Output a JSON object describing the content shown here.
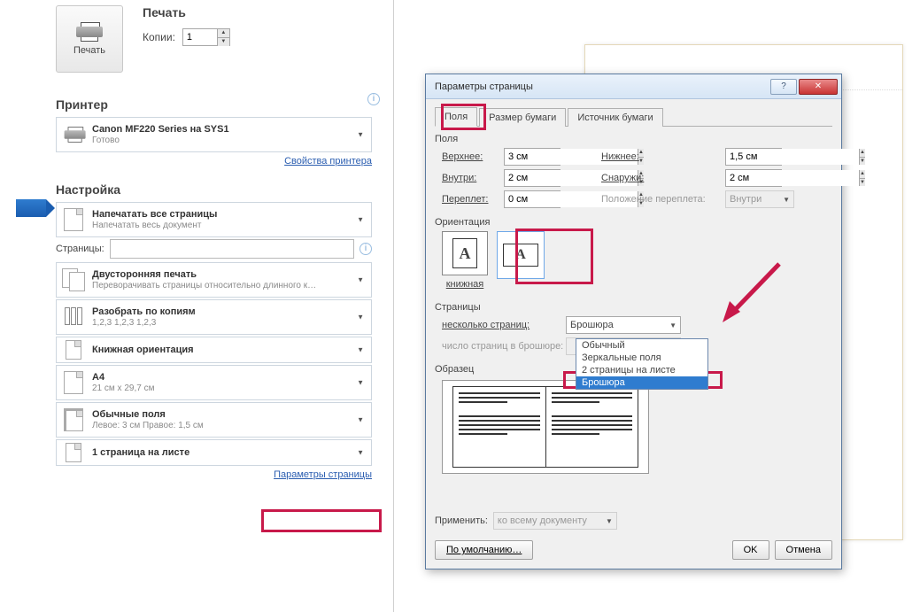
{
  "print_panel": {
    "title": "Печать",
    "print_button": "Печать",
    "copies_label": "Копии:",
    "copies_value": "1",
    "printer_section": "Принтер",
    "printer_name": "Canon MF220 Series на SYS1",
    "printer_status": "Готово",
    "printer_props_link": "Свойства принтера",
    "settings_section": "Настройка",
    "opt_allpages_title": "Напечатать все страницы",
    "opt_allpages_sub": "Напечатать весь документ",
    "pages_label": "Страницы:",
    "pages_value": "",
    "opt_duplex_title": "Двусторонняя печать",
    "opt_duplex_sub": "Переворачивать страницы относительно длинного к…",
    "opt_collate_title": "Разобрать по копиям",
    "opt_collate_sub": "1,2,3   1,2,3   1,2,3",
    "opt_orient_title": "Книжная ориентация",
    "opt_paper_title": "A4",
    "opt_paper_sub": "21 см x 29,7 см",
    "opt_margins_title": "Обычные поля",
    "opt_margins_sub": "Левое: 3 см   Правое: 1,5 см",
    "opt_perpage_title": "1 страница на листе",
    "page_params_link": "Параметры страницы"
  },
  "dialog": {
    "title": "Параметры страницы",
    "tabs": {
      "fields": "Поля",
      "paper": "Размер бумаги",
      "source": "Источник бумаги"
    },
    "fields_group": "Поля",
    "labels": {
      "top": "Верхнее:",
      "bottom": "Нижнее:",
      "inside": "Внутри:",
      "outside": "Снаружи:",
      "gutter": "Переплет:",
      "gutter_pos": "Положение переплета:"
    },
    "values": {
      "top": "3 см",
      "bottom": "1,5 см",
      "inside": "2 см",
      "outside": "2 см",
      "gutter": "0 см",
      "gutter_pos": "Внутри"
    },
    "orientation_group": "Ориентация",
    "orientation_portrait": "книжная",
    "pages_group": "Страницы",
    "multipage_label": "несколько страниц:",
    "multipage_value": "Брошюра",
    "multipage_options": [
      "Обычный",
      "Зеркальные поля",
      "2 страницы на листе",
      "Брошюра"
    ],
    "brochure_pages_label": "число страниц в брошюре:",
    "sample_group": "Образец",
    "apply_label": "Применить:",
    "apply_value": "ко всему документу",
    "buttons": {
      "default": "По умолчанию…",
      "ok": "OK",
      "cancel": "Отмена"
    }
  }
}
